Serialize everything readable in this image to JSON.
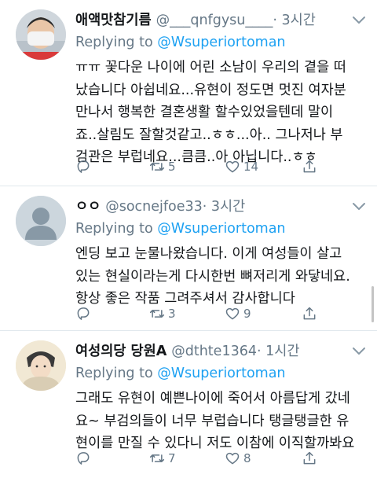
{
  "tweets": [
    {
      "name": "애액맛참기름",
      "handle": "@___qnfgysu____",
      "time": "· 3시간",
      "reply_prefix": "Replying to ",
      "reply_to": "@Wsuperiortoman",
      "lines": [
        "ㅠㅠ 꽃다운 나이에 어린 소남이 우리의 곁을 떠",
        "났습니다 아쉽네요...유현이 정도면 멋진 여자분",
        "만나서 행복한 결혼생활 할수있었을텐데 말이",
        "죠..살림도 잘할것같고..ㅎㅎ...아.. 그나저나 부",
        "검관은 부럽네요...큼큼..아 아닙니다..ㅎㅎ"
      ],
      "retweets": "5",
      "likes": "14"
    },
    {
      "name": "ㅇㅇ",
      "handle": "@socnejfoe33",
      "time": "· 3시간",
      "reply_prefix": "Replying to ",
      "reply_to": "@Wsuperiortoman",
      "lines": [
        "엔딩 보고 눈물나왔습니다. 이게 여성들이 살고",
        "있는 현실이라는게 다시한번 뼈저리게 와닿네요.",
        "항상 좋은 작품 그려주셔서 감사합니다"
      ],
      "retweets": "3",
      "likes": "9"
    },
    {
      "name": "여성의당 당원A",
      "handle": "@dthte1364",
      "time": "· 1시간",
      "reply_prefix": "Replying to ",
      "reply_to": "@Wsuperiortoman",
      "lines": [
        "그래도 유현이 예쁜나이에 죽어서 아름답게 갔네",
        "요~ 부검의들이 너무 부럽습니다 탱글탱글한 유",
        "현이를 만질 수 있다니 저도 이참에 이직할까봐요"
      ],
      "retweets": "7",
      "likes": "8"
    }
  ],
  "icons": {
    "reply": "reply-icon",
    "retweet": "retweet-icon",
    "like": "heart-icon",
    "share": "share-icon",
    "more": "chevron-down-icon"
  },
  "colors": {
    "text": "#14171a",
    "secondary": "#657786",
    "link": "#1da1f2",
    "divider": "#e1e8ed"
  }
}
